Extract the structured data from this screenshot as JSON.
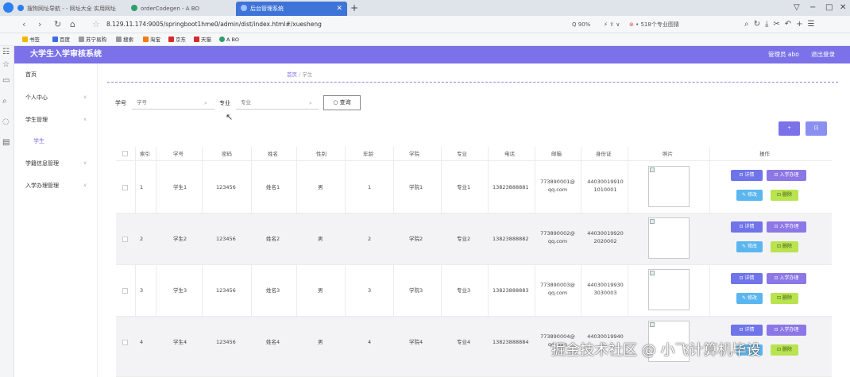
{
  "browser": {
    "tabs": [
      {
        "label": "搜狗网址导航 - - 网址大全 实用网址"
      },
      {
        "label": "orderCodegen - A BO"
      },
      {
        "label": "后台管理系统"
      }
    ],
    "new_tab": "+",
    "window_controls": [
      "▽",
      "−",
      "□",
      "✕"
    ],
    "url": "8.129.11.174:9005/springboot1hme0/admin/dist/index.html#/xuesheng",
    "zoom": "Q 90%",
    "hot_topic": "518个专业图猜",
    "bookmarks": [
      "书签",
      "百度",
      "苏宁易购",
      "搜索",
      "淘宝",
      "京东",
      "天猫",
      "A BO"
    ]
  },
  "app": {
    "title": "大学生入学审核系统",
    "user": "管理员 abo",
    "logout": "退出登录"
  },
  "sidebar": {
    "items": [
      {
        "label": "首页"
      },
      {
        "label": "个人中心"
      },
      {
        "label": "学生管理"
      },
      {
        "label": "学生"
      },
      {
        "label": "学籍信息管理"
      },
      {
        "label": "入学办理管理"
      }
    ]
  },
  "breadcrumb": {
    "home": "首页",
    "sep": "/",
    "current": "学生"
  },
  "search": {
    "student_no_label": "学号",
    "student_no_placeholder": "学号",
    "major_label": "专业",
    "major_placeholder": "专业",
    "query_button": "○ 查询"
  },
  "actions": {
    "add_label": "+",
    "delete_label": "⊡"
  },
  "table": {
    "headers": [
      "",
      "索引",
      "学号",
      "密码",
      "姓名",
      "性别",
      "年龄",
      "学院",
      "专业",
      "电话",
      "邮箱",
      "身份证",
      "照片",
      "操作"
    ],
    "rows": [
      {
        "index": "1",
        "student_no": "学生1",
        "password": "123456",
        "name": "姓名1",
        "gender": "男",
        "age": "1",
        "college": "学院1",
        "major": "专业1",
        "phone": "13823888881",
        "email": [
          "773890001@",
          "qq.com"
        ],
        "id_card": [
          "44030019910",
          "1010001"
        ]
      },
      {
        "index": "2",
        "student_no": "学生2",
        "password": "123456",
        "name": "姓名2",
        "gender": "男",
        "age": "2",
        "college": "学院2",
        "major": "专业2",
        "phone": "13823888882",
        "email": [
          "773890002@",
          "qq.com"
        ],
        "id_card": [
          "44030019920",
          "2020002"
        ]
      },
      {
        "index": "3",
        "student_no": "学生3",
        "password": "123456",
        "name": "姓名3",
        "gender": "男",
        "age": "3",
        "college": "学院3",
        "major": "专业3",
        "phone": "13823888883",
        "email": [
          "773890003@",
          "qq.com"
        ],
        "id_card": [
          "44030019930",
          "3030003"
        ]
      },
      {
        "index": "4",
        "student_no": "学生4",
        "password": "123456",
        "name": "姓名4",
        "gender": "男",
        "age": "4",
        "college": "学院4",
        "major": "专业4",
        "phone": "13823888884",
        "email": [
          "773890004@",
          "qq.com"
        ],
        "id_card": [
          "44030019940",
          ""
        ]
      }
    ],
    "op_buttons": {
      "detail": "⊡ 详情",
      "admit": "⊡ 入学办理",
      "edit": "✎ 修改",
      "delete": "⊡ 删除"
    }
  },
  "watermark": "掘金技术社区 @ 小飞计算机毕设",
  "colors": {
    "accent": "#7b72e9",
    "tab_active": "#3e73d8",
    "btn_edit": "#5bb6f0",
    "btn_delete": "#b9e34f"
  }
}
